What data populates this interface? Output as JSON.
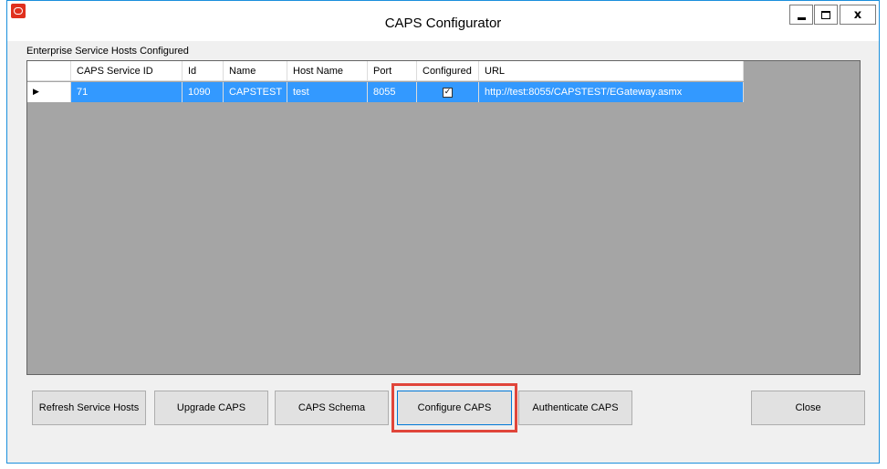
{
  "window": {
    "title": "CAPS Configurator",
    "close_glyph": "x",
    "app_icon": "oracle-logo-icon"
  },
  "grid": {
    "group_label": "Enterprise Service Hosts Configured",
    "columns": [
      "CAPS Service ID",
      "Id",
      "Name",
      "Host Name",
      "Port",
      "Configured",
      "URL"
    ],
    "rows": [
      {
        "caps_service_id": "71",
        "id": "1090",
        "name": "CAPSTEST",
        "host_name": "test",
        "port": "8055",
        "configured": true,
        "url": "http://test:8055/CAPSTEST/EGateway.asmx",
        "selected": true
      }
    ]
  },
  "buttons": {
    "refresh": "Refresh Service Hosts",
    "upgrade": "Upgrade CAPS",
    "schema": "CAPS Schema",
    "configure": "Configure CAPS",
    "authenticate": "Authenticate CAPS",
    "close": "Close"
  },
  "colors": {
    "selection": "#3399ff",
    "grid_background": "#a5a5a5",
    "highlight_box": "#e0453a"
  }
}
